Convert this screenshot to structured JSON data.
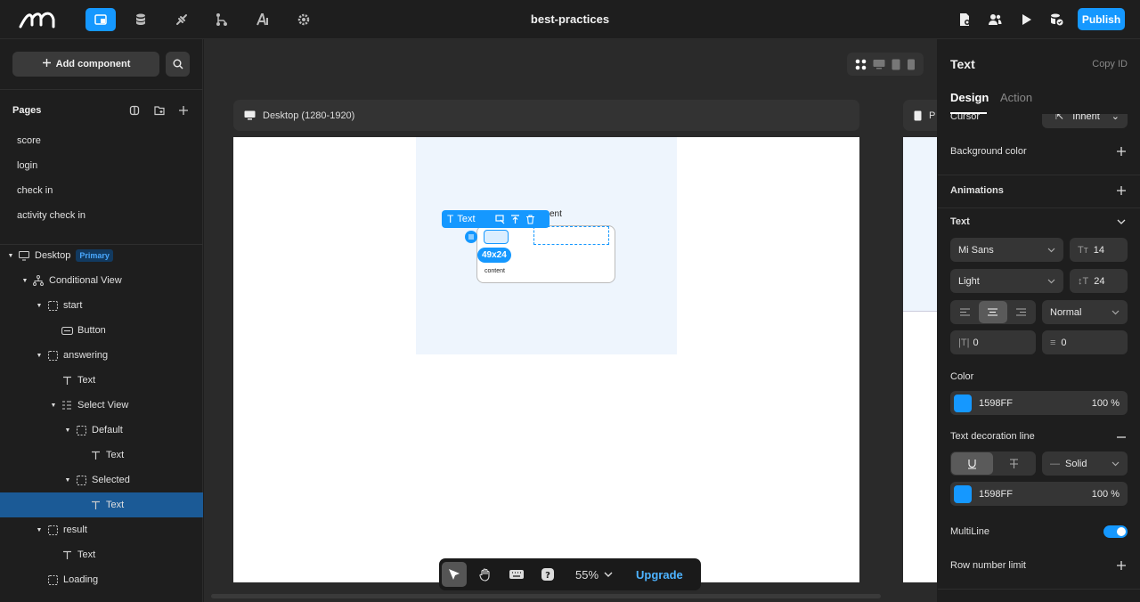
{
  "header": {
    "title": "best-practices",
    "publish_label": "Publish",
    "icons": [
      "pages-icon",
      "database-icon",
      "plugin-icon",
      "workflow-icon",
      "ai-icon",
      "settings-icon"
    ],
    "right_icons": [
      "file-settings-icon",
      "users-icon",
      "play-icon",
      "database-check-icon"
    ],
    "accent": "#1598FF"
  },
  "left": {
    "add_component": "Add component",
    "pages_title": "Pages",
    "pages": [
      "score",
      "login",
      "check in",
      "activity check in"
    ],
    "tree": [
      {
        "label": "Desktop",
        "badge": "Primary",
        "icon": "desktop-icon",
        "depth": 0,
        "arrow": true
      },
      {
        "label": "Conditional View",
        "icon": "conditional-icon",
        "depth": 1,
        "arrow": true
      },
      {
        "label": "start",
        "icon": "container-icon",
        "depth": 2,
        "arrow": true
      },
      {
        "label": "Button",
        "icon": "button-icon",
        "depth": 3,
        "arrow": false
      },
      {
        "label": "answering",
        "icon": "container-icon",
        "depth": 2,
        "arrow": true
      },
      {
        "label": "Text",
        "icon": "text-icon",
        "depth": 3,
        "arrow": false
      },
      {
        "label": "Select View",
        "icon": "select-view-icon",
        "depth": 3,
        "arrow": true
      },
      {
        "label": "Default",
        "icon": "container-icon",
        "depth": 4,
        "arrow": true
      },
      {
        "label": "Text",
        "icon": "text-icon",
        "depth": 5,
        "arrow": false
      },
      {
        "label": "Selected",
        "icon": "container-icon",
        "depth": 4,
        "arrow": true
      },
      {
        "label": "Text",
        "icon": "text-icon",
        "depth": 5,
        "arrow": false,
        "selected": true
      },
      {
        "label": "result",
        "icon": "container-icon",
        "depth": 2,
        "arrow": true
      },
      {
        "label": "Text",
        "icon": "text-icon",
        "depth": 3,
        "arrow": false
      },
      {
        "label": "Loading",
        "icon": "container-icon",
        "depth": 2,
        "arrow": false
      }
    ]
  },
  "canvas": {
    "device_label": "Desktop (1280-1920)",
    "device2_label": "P",
    "text_tool_label": "Text",
    "dims": "49x24",
    "content_text": "content",
    "hidden_text": "ent",
    "zoom": "55%",
    "upgrade": "Upgrade"
  },
  "right": {
    "title": "Text",
    "copy_id": "Copy ID",
    "tabs": [
      "Design",
      "Action"
    ],
    "cursor_label": "Cursor",
    "cursor_value": "Inherit",
    "background_color": "Background color",
    "animations": "Animations",
    "text_section": "Text",
    "font": "Mi Sans",
    "font_size": "14",
    "weight": "Light",
    "line_height": "24",
    "text_transform": "Normal",
    "letter_spacing": "0",
    "para_spacing": "0",
    "color_label": "Color",
    "color_hex": "1598FF",
    "color_opacity": "100 %",
    "decoration_label": "Text decoration line",
    "decoration_style": "Solid",
    "deco_hex": "1598FF",
    "deco_opacity": "100 %",
    "multiline": "MultiLine",
    "multiline_on": true,
    "row_limit": "Row number limit"
  }
}
